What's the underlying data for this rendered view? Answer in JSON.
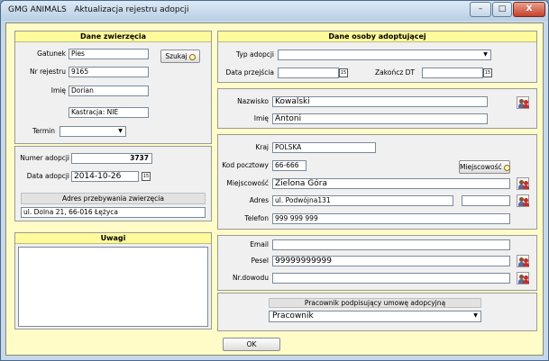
{
  "window": {
    "app_name": "GMG ANIMALS",
    "title": "Aktualizacja rejestru adopcji",
    "minimize": "–",
    "maximize": "□",
    "close": "X"
  },
  "animal": {
    "header": "Dane zwierzęcia",
    "species_label": "Gatunek",
    "species_value": "Pies",
    "search_button": "Szukaj",
    "register_label": "Nr rejestru",
    "register_value": "9165",
    "name_label": "Imię",
    "name_value": "Dorian",
    "castration_value": "Kastracja: NIE",
    "term_label": "Termin",
    "term_value": ""
  },
  "adoption": {
    "number_label": "Numer adopcji",
    "number_value": "3737",
    "date_label": "Data adopcji",
    "date_value": "2014-10-26",
    "address_header": "Adres przebywania zwierzęcia",
    "address_value": "ul. Dolna 21, 66-016 Łężyca"
  },
  "notes": {
    "header": "Uwagi",
    "value": ""
  },
  "person": {
    "header": "Dane osoby adoptującej",
    "adoption_type_label": "Typ adopcji",
    "adoption_type_value": "",
    "takeover_date_label": "Data przejścia",
    "takeover_date_value": "",
    "end_dt_label": "Zakończ DT",
    "end_dt_value": "",
    "surname_label": "Nazwisko",
    "surname_value": "Kowalski",
    "firstname_label": "Imię",
    "firstname_value": "Antoni",
    "country_label": "Kraj",
    "country_value": "POLSKA",
    "postal_label": "Kod pocztowy",
    "postal_value": "66-666",
    "city_button": "Miejscowość",
    "city_label": "Miejscowość",
    "city_value": "Zielona Góra",
    "address_label": "Adres",
    "address_value": "ul. Podwójna131",
    "address_extra_value": "",
    "phone_label": "Telefon",
    "phone_value": "999 999 999",
    "email_label": "Email",
    "email_value": "",
    "pesel_label": "Pesel",
    "pesel_value": "99999999999",
    "id_label": "Nr.dowodu",
    "id_value": ""
  },
  "employee": {
    "header": "Pracownik podpisujący umowę adopcyjną",
    "value": "Pracownik"
  },
  "footer": {
    "ok_button": "OK"
  },
  "icons": {
    "calendar": "calendar-icon",
    "dropdown": "chevron-down-icon",
    "search": "magnifier-icon",
    "people": "users-icon"
  }
}
